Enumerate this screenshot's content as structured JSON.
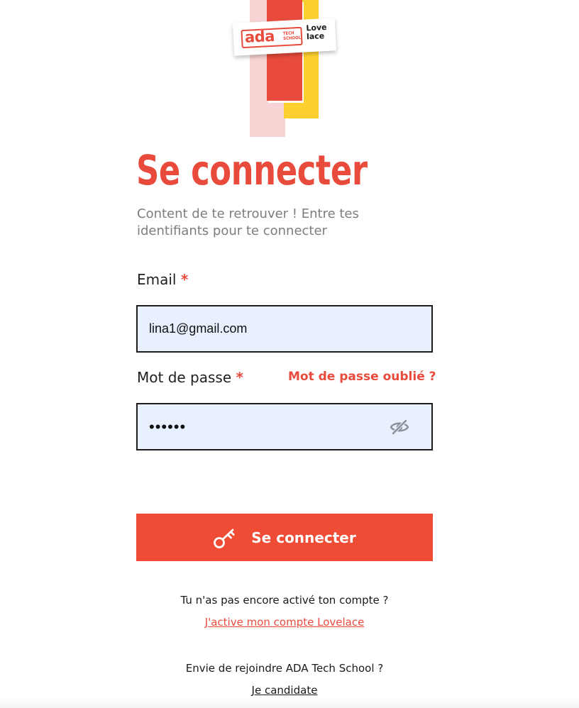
{
  "logo": {
    "ada": "ada",
    "ada_sub": "TECH SCHOOL",
    "partner": "Love lace",
    "alt": "ada Tech School - Lovelace"
  },
  "header": {
    "title": "Se connecter",
    "subtitle": "Content de te retrouver ! Entre tes identifiants pour te connecter"
  },
  "form": {
    "email": {
      "label": "Email",
      "required_mark": "*",
      "value": "lina1@gmail.com"
    },
    "password": {
      "label": "Mot de passe",
      "required_mark": "*",
      "value": "••••••",
      "forgot_label": "Mot de passe oublié ?",
      "toggle_icon": "eye-slash-icon"
    },
    "submit": {
      "label": "Se connecter",
      "icon": "key-icon"
    }
  },
  "footer": {
    "activate_question": "Tu n'as pas encore activé ton compte ?",
    "activate_link": "J'active mon compte Lovelace",
    "join_question": "Envie de rejoindre ADA Tech School ?",
    "join_link": "Je candidate"
  },
  "colors": {
    "accent": "#e84b3c",
    "button": "#ef4b35",
    "input_bg": "#e8f0fe",
    "yellow": "#fed02f",
    "pink": "#f7d4d3"
  }
}
